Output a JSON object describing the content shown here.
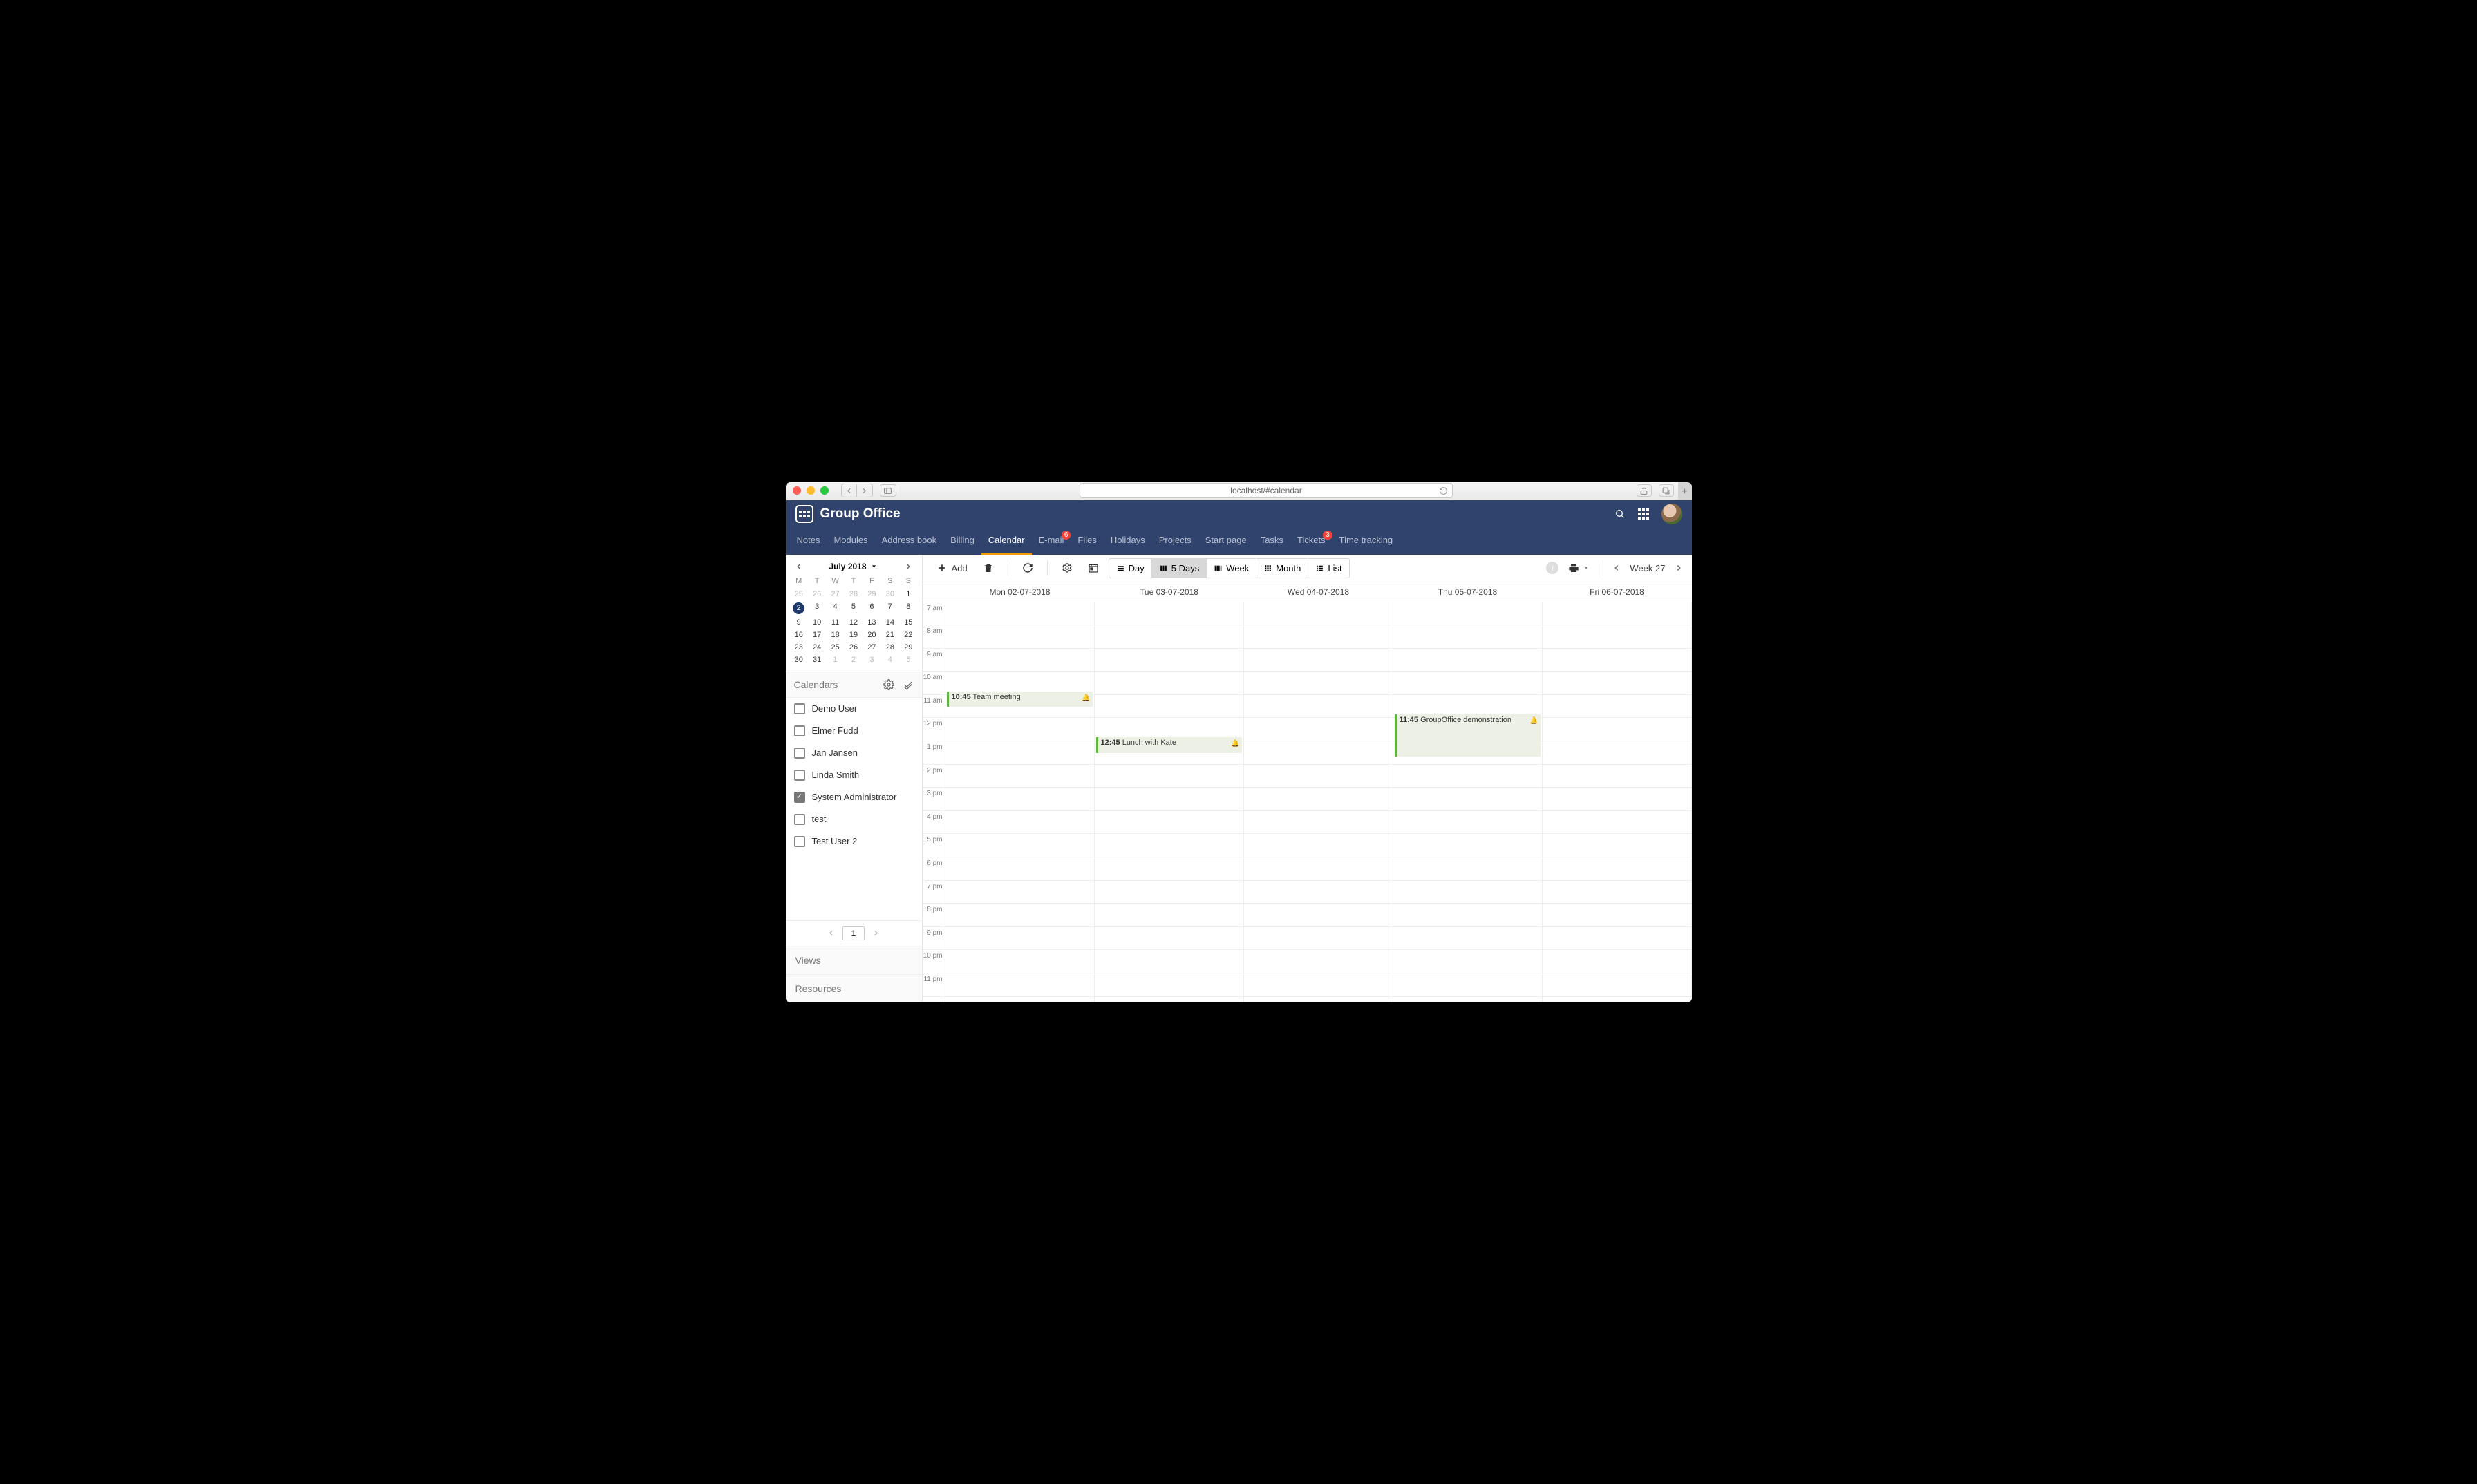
{
  "browser": {
    "url": "localhost/#calendar"
  },
  "brand": "Group Office",
  "nav": [
    {
      "label": "Notes"
    },
    {
      "label": "Modules"
    },
    {
      "label": "Address book"
    },
    {
      "label": "Billing"
    },
    {
      "label": "Calendar",
      "active": true
    },
    {
      "label": "E-mail",
      "badge": "6"
    },
    {
      "label": "Files"
    },
    {
      "label": "Holidays"
    },
    {
      "label": "Projects"
    },
    {
      "label": "Start page"
    },
    {
      "label": "Tasks"
    },
    {
      "label": "Tickets",
      "badge": "3"
    },
    {
      "label": "Time tracking"
    }
  ],
  "minical": {
    "title": "July 2018",
    "dow": [
      "M",
      "T",
      "W",
      "T",
      "F",
      "S",
      "S"
    ],
    "days": [
      {
        "n": "25",
        "o": true
      },
      {
        "n": "26",
        "o": true
      },
      {
        "n": "27",
        "o": true
      },
      {
        "n": "28",
        "o": true
      },
      {
        "n": "29",
        "o": true
      },
      {
        "n": "30",
        "o": true
      },
      {
        "n": "1"
      },
      {
        "n": "2",
        "sel": true
      },
      {
        "n": "3"
      },
      {
        "n": "4"
      },
      {
        "n": "5"
      },
      {
        "n": "6"
      },
      {
        "n": "7"
      },
      {
        "n": "8"
      },
      {
        "n": "9"
      },
      {
        "n": "10"
      },
      {
        "n": "11"
      },
      {
        "n": "12"
      },
      {
        "n": "13"
      },
      {
        "n": "14"
      },
      {
        "n": "15"
      },
      {
        "n": "16"
      },
      {
        "n": "17"
      },
      {
        "n": "18"
      },
      {
        "n": "19"
      },
      {
        "n": "20"
      },
      {
        "n": "21"
      },
      {
        "n": "22"
      },
      {
        "n": "23"
      },
      {
        "n": "24"
      },
      {
        "n": "25"
      },
      {
        "n": "26"
      },
      {
        "n": "27"
      },
      {
        "n": "28"
      },
      {
        "n": "29"
      },
      {
        "n": "30"
      },
      {
        "n": "31"
      },
      {
        "n": "1",
        "o": true
      },
      {
        "n": "2",
        "o": true
      },
      {
        "n": "3",
        "o": true
      },
      {
        "n": "4",
        "o": true
      },
      {
        "n": "5",
        "o": true
      }
    ]
  },
  "sections": {
    "calendars": "Calendars",
    "views": "Views",
    "resources": "Resources"
  },
  "calendars": [
    {
      "name": "Demo User",
      "checked": false
    },
    {
      "name": "Elmer Fudd",
      "checked": false
    },
    {
      "name": "Jan Jansen",
      "checked": false
    },
    {
      "name": "Linda Smith",
      "checked": false
    },
    {
      "name": "System Administrator",
      "checked": true
    },
    {
      "name": "test",
      "checked": false
    },
    {
      "name": "Test User 2",
      "checked": false
    }
  ],
  "pager": {
    "page": "1"
  },
  "toolbar": {
    "add": "Add",
    "views": {
      "day": "Day",
      "five": "5 Days",
      "week": "Week",
      "month": "Month",
      "list": "List"
    },
    "week_label": "Week 27"
  },
  "days": [
    "Mon 02-07-2018",
    "Tue 03-07-2018",
    "Wed 04-07-2018",
    "Thu 05-07-2018",
    "Fri 06-07-2018"
  ],
  "hours": [
    "7 am",
    "8 am",
    "9 am",
    "10 am",
    "11 am",
    "12 pm",
    "1 pm",
    "2 pm",
    "3 pm",
    "4 pm",
    "5 pm",
    "6 pm",
    "7 pm",
    "8 pm",
    "9 pm",
    "10 pm",
    "11 pm"
  ],
  "events": [
    {
      "day": 0,
      "top_pct": 22.3,
      "height_pct": 3.9,
      "time": "10:45",
      "title": "Team meeting"
    },
    {
      "day": 1,
      "top_pct": 33.8,
      "height_pct": 3.9,
      "time": "12:45",
      "title": "Lunch with Kate"
    },
    {
      "day": 3,
      "top_pct": 28.0,
      "height_pct": 10.6,
      "time": "11:45",
      "title": "GroupOffice demonstration"
    }
  ]
}
